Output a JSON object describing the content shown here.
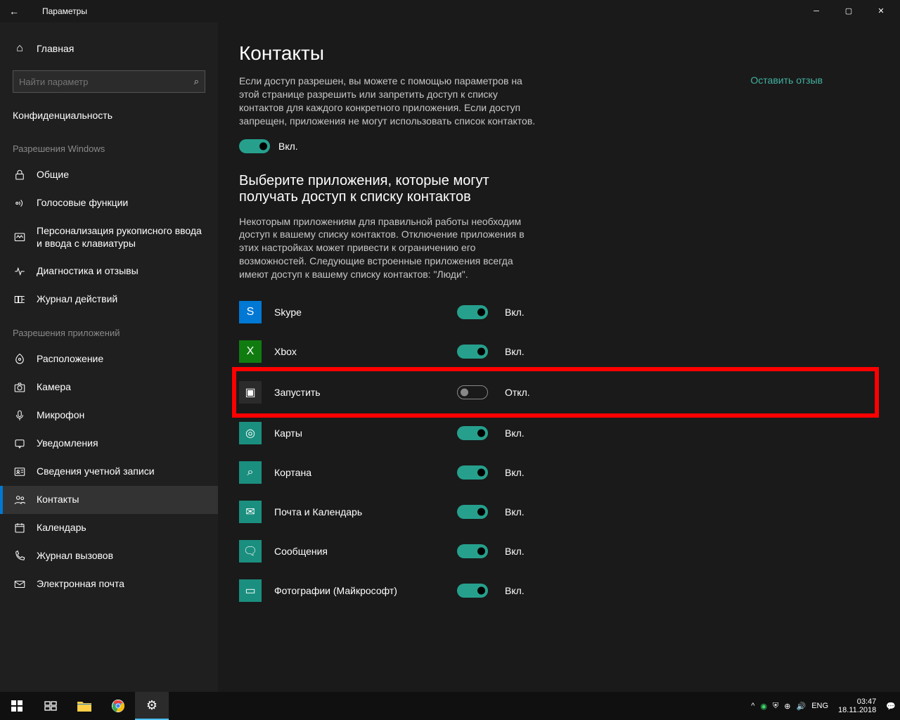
{
  "titlebar": {
    "title": "Параметры"
  },
  "sidebar": {
    "home": "Главная",
    "search_placeholder": "Найти параметр",
    "section": "Конфиденциальность",
    "group_windows": "Разрешения Windows",
    "items_windows": [
      "Общие",
      "Голосовые функции",
      "Персонализация рукописного ввода и ввода с клавиатуры",
      "Диагностика и отзывы",
      "Журнал действий"
    ],
    "group_apps": "Разрешения приложений",
    "items_apps": [
      "Расположение",
      "Камера",
      "Микрофон",
      "Уведомления",
      "Сведения учетной записи",
      "Контакты",
      "Календарь",
      "Журнал вызовов",
      "Электронная почта"
    ]
  },
  "main": {
    "title": "Контакты",
    "feedback": "Оставить отзыв",
    "desc1": "Если доступ разрешен, вы можете с помощью параметров на этой странице разрешить или запретить доступ к списку контактов для каждого конкретного приложения. Если доступ запрещен, приложения не могут использовать список контактов.",
    "master_state": "Вкл.",
    "sub_title": "Выберите приложения, которые могут получать доступ к списку контактов",
    "desc2": "Некоторым приложениям для правильной работы необходим доступ к вашему списку контактов. Отключение приложения в этих настройках может привести к ограничению его возможностей. Следующие встроенные приложения всегда имеют доступ к вашему списку контактов: \"Люди\".",
    "apps": [
      {
        "name": "Skype",
        "state": "Вкл.",
        "on": true,
        "color": "#0078d4",
        "glyph": "S"
      },
      {
        "name": "Xbox",
        "state": "Вкл.",
        "on": true,
        "color": "#107c10",
        "glyph": "X"
      },
      {
        "name": "Запустить",
        "state": "Откл.",
        "on": false,
        "color": "#2b2b2b",
        "glyph": "▣",
        "highlight": true
      },
      {
        "name": "Карты",
        "state": "Вкл.",
        "on": true,
        "color": "#1b8f7f",
        "glyph": "◎"
      },
      {
        "name": "Кортана",
        "state": "Вкл.",
        "on": true,
        "color": "#1b8f7f",
        "glyph": "⌕"
      },
      {
        "name": "Почта и Календарь",
        "state": "Вкл.",
        "on": true,
        "color": "#1b8f7f",
        "glyph": "✉"
      },
      {
        "name": "Сообщения",
        "state": "Вкл.",
        "on": true,
        "color": "#1b8f7f",
        "glyph": "🗨"
      },
      {
        "name": "Фотографии (Майкрософт)",
        "state": "Вкл.",
        "on": true,
        "color": "#1b8f7f",
        "glyph": "▭"
      }
    ]
  },
  "taskbar": {
    "lang": "ENG",
    "time": "03:47",
    "date": "18.11.2018"
  }
}
